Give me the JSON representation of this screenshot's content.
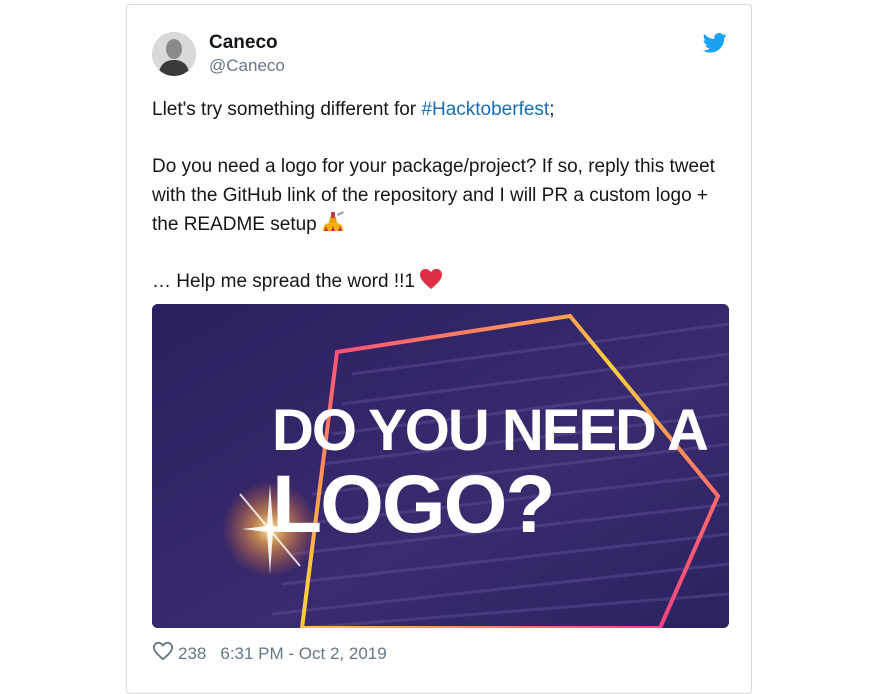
{
  "tweet": {
    "author_name": "Caneco",
    "author_handle": "@Caneco",
    "line1_prefix": "Llet's try something different for ",
    "hashtag": "#Hacktoberfest",
    "line1_suffix": ";",
    "paragraph2": "Do you need a logo for your package/project? If so, reply this tweet with the GitHub link of the repository and I will PR a custom logo + the README setup",
    "paragraph3": "… Help me spread the word !!1",
    "image_text_line1": "DO YOU NEED A",
    "image_text_line2": "LOGO?",
    "like_count": "238",
    "timestamp": "6:31 PM - Oct 2, 2019"
  },
  "icons": {
    "platform": "twitter-bird-icon",
    "like": "heart-outline-icon",
    "emoji_painting": "nail-polish-emoji",
    "emoji_heart": "red-heart-emoji"
  },
  "colors": {
    "brand": "#1da1f2",
    "hashtag": "#1b6db5",
    "heart": "#e0245e",
    "image_bg": "#211a4d"
  }
}
